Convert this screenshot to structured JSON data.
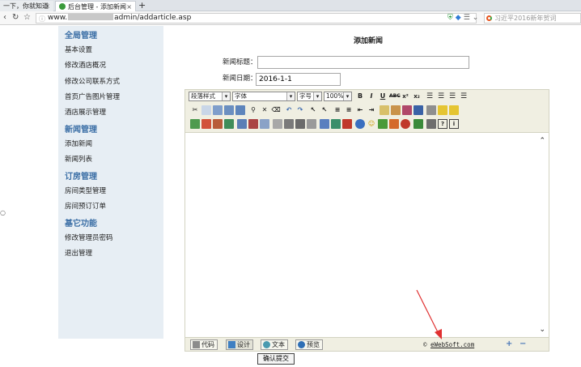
{
  "browser": {
    "tabs": [
      {
        "label": "一下，你就知道",
        "close": "×"
      },
      {
        "label": "后台管理 - 添加新闻",
        "close": "×"
      }
    ],
    "new_tab": "+",
    "address": {
      "prefix": "www.",
      "suffix": "admin/addarticle.asp"
    },
    "search_placeholder": "习近平2016新年贺词"
  },
  "sidebar": {
    "groups": [
      {
        "title": "全局管理",
        "items": [
          "基本设置",
          "修改酒店概况",
          "修改公司联系方式",
          "首页广告图片管理",
          "酒店展示管理"
        ]
      },
      {
        "title": "新闻管理",
        "items": [
          "添加新闻",
          "新闻列表"
        ]
      },
      {
        "title": "订房管理",
        "items": [
          "房间类型管理",
          "房间预订订单"
        ]
      },
      {
        "title": "基它功能",
        "items": [
          "修改管理员密码",
          "退出管理"
        ]
      }
    ]
  },
  "form": {
    "title": "添加新闻",
    "news_title_label": "新闻标题：",
    "news_title_value": "",
    "news_date_label": "新闻日期：",
    "news_date_value": "2016-1-1",
    "submit_label": "确认提交"
  },
  "editor": {
    "selects": {
      "style": "段落样式",
      "font": "字体",
      "size": "字号",
      "zoom": "100%"
    },
    "format_buttons": [
      "B",
      "I",
      "U",
      "ABC",
      "x²",
      "x₂"
    ],
    "modes": [
      "代码",
      "设计",
      "文本",
      "预览"
    ],
    "credit_prefix": "© ",
    "credit_link": "eWebSoft.com",
    "zoom_in": "+",
    "zoom_out": "−"
  },
  "colors": {
    "sidebar_bg": "#e7eef4",
    "sidebar_heading": "#3a6ea5",
    "toolbar_bg": "#f0efe2",
    "annotation_arrow": "#e03030"
  }
}
